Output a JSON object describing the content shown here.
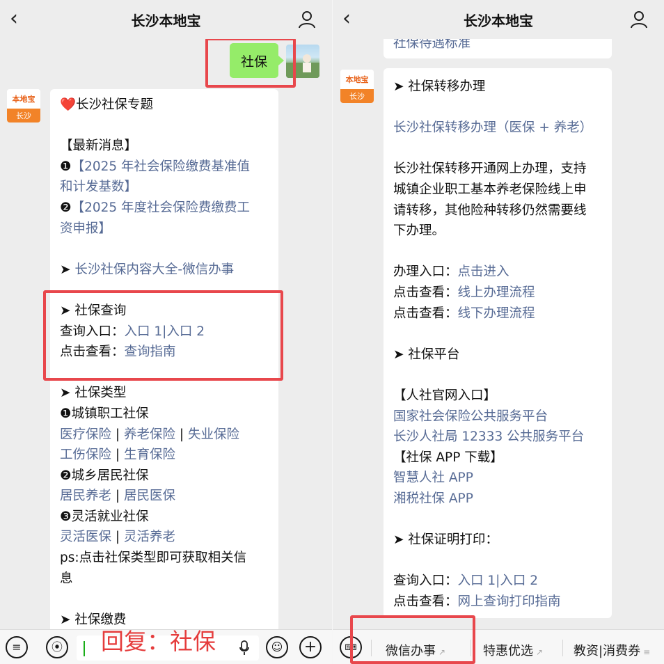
{
  "app": {
    "title": "长沙本地宝",
    "back_icon": "chevron-left-icon",
    "profile_icon": "person-icon"
  },
  "account": {
    "logo_text": "本地宝",
    "logo_city": "长沙"
  },
  "user_message": "社保",
  "left_bubble": {
    "title": "❤️长沙社保专题",
    "news_header": "【最新消息】",
    "news1_num": "❶",
    "news1_line1": "【2025 年社会保险缴费基准值",
    "news1_line2": "和计发基数】",
    "news2_num": "❷",
    "news2_line1": "【2025 年度社会保险费缴费工",
    "news2_line2": "资申报】",
    "arrow": "➤",
    "all_link": "长沙社保内容大全-微信办事",
    "query_title": "社保查询",
    "query_entry_label": "查询入口：",
    "query_entry_1": "入口 1",
    "query_sep": "|",
    "query_entry_2": "入口 2",
    "guide_label": "点击查看：",
    "guide_link": "查询指南",
    "types_title": "社保类型",
    "type1": "❶城镇职工社保",
    "type1_links_a": "医疗保险",
    "type1_links_b": "养老保险",
    "type1_links_c": "失业保险",
    "type1_links_d": "工伤保险",
    "type1_links_e": "生育保险",
    "type2": "❷城乡居民社保",
    "type2_links_a": "居民养老",
    "type2_links_b": "居民医保",
    "type3": "❸灵活就业社保",
    "type3_links_a": "灵活医保",
    "type3_links_b": "灵活养老",
    "bar": " | ",
    "ps_line1": "ps:点击社保类型即可获取相关信",
    "ps_line2": "息",
    "payment_title": "社保缴费"
  },
  "right_bubble": {
    "top_cut": "社保待遇标准",
    "arrow": "➤",
    "transfer_title": "社保转移办理",
    "transfer_link": "长沙社保转移办理（医保 + 养老）",
    "transfer_desc1": "长沙社保转移开通网上办理，支持",
    "transfer_desc2": "城镇企业职工基本养老保险线上申",
    "transfer_desc3": "请转移，其他险种转移仍然需要线",
    "transfer_desc4": "下办理。",
    "handle_label": "办理入口：",
    "handle_link": "点击进入",
    "view_label": "点击查看：",
    "online_flow": "线上办理流程",
    "offline_flow": "线下办理流程",
    "platform_title": "社保平台",
    "hr_header": "【人社官网入口】",
    "national_link": "国家社会保险公共服务平台",
    "cs_link": "长沙人社局 12333 公共服务平台",
    "app_header": "【社保 APP 下载】",
    "app1": "智慧人社 APP",
    "app2": "湘税社保 APP",
    "print_title": "社保证明打印：",
    "query_label": "查询入口：",
    "entry1": "入口 1",
    "sep": "|",
    "entry2": "入口 2",
    "print_guide": "网上查询打印指南"
  },
  "left_bottom": {
    "menu_icon": "list-icon",
    "voice_icon": "voice-icon",
    "mic_icon": "microphone-icon",
    "emoji_icon": "emoji-icon",
    "plus_icon": "plus-icon",
    "reply_text": "回复：社保"
  },
  "right_bottom": {
    "keyboard_icon": "keyboard-icon",
    "menu1": "微信办事",
    "menu2": "特惠优选",
    "menu3": "教资|消费券",
    "link_icon": "link-icon",
    "more_icon": "menu-lines-icon"
  },
  "colors": {
    "link": "#576b95",
    "highlight": "#e8474c",
    "my_bubble": "#95ec69",
    "background": "#ededed"
  }
}
